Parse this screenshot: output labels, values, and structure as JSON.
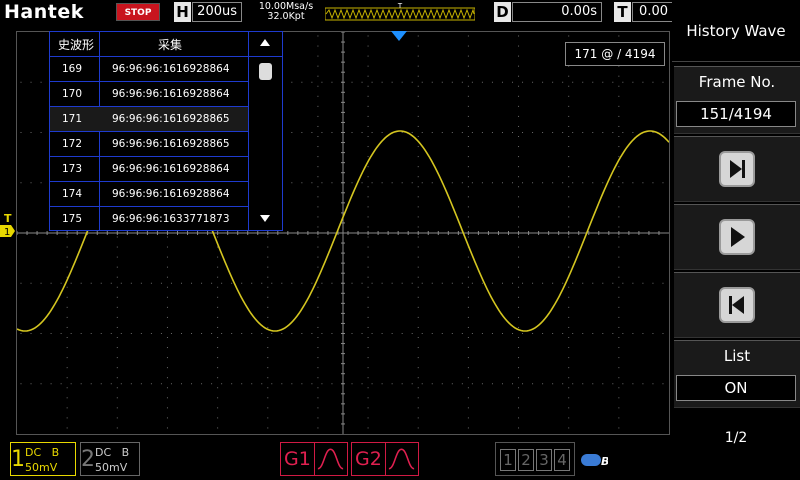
{
  "header": {
    "brand": "Hantek",
    "run_state": "STOP",
    "horizontal": {
      "letter": "H",
      "value": "200us"
    },
    "sample_rate": "10.00Msa/s",
    "memory_depth": "32.0Kpt",
    "trigger_marker": "T",
    "delay": {
      "letter": "D",
      "value": "0.00s"
    },
    "trigger_time": {
      "letter": "T",
      "value": "0.00"
    }
  },
  "screen": {
    "trigger_level_label": "T",
    "channel_marker": "1",
    "frame_readout": "171 @ / 4194"
  },
  "history_table": {
    "col1_header": "史波形",
    "col2_header": "采集",
    "rows": [
      {
        "index": "169",
        "timestamp": "96:96:96:1616928864"
      },
      {
        "index": "170",
        "timestamp": "96:96:96:1616928864"
      },
      {
        "index": "171",
        "timestamp": "96:96:96:1616928865"
      },
      {
        "index": "172",
        "timestamp": "96:96:96:1616928865"
      },
      {
        "index": "173",
        "timestamp": "96:96:96:1616928864"
      },
      {
        "index": "174",
        "timestamp": "96:96:96:1616928864"
      },
      {
        "index": "175",
        "timestamp": "96:96:96:1633771873"
      }
    ],
    "selected_index": "171"
  },
  "bottom": {
    "ch1": {
      "num": "1",
      "coupling": "DC",
      "bw": "B",
      "scale": "50mV"
    },
    "ch2": {
      "num": "2",
      "coupling": "DC",
      "bw": "B",
      "scale": "50mV"
    },
    "g1": "G1",
    "g2": "G2",
    "channel_selectors": [
      "1",
      "2",
      "3",
      "4"
    ],
    "bus_icon": "B"
  },
  "right_panel": {
    "title": "History Wave",
    "frame_label": "Frame No.",
    "frame_value": "151/4194",
    "buttons": [
      "next-frame-icon",
      "play-icon",
      "previous-frame-icon"
    ],
    "list_label": "List",
    "list_value": "ON",
    "page": "1/2"
  },
  "colors": {
    "trace": "#d4c520",
    "ch1": "#e8d800",
    "accent_red": "#c8141e",
    "grid": "#6a6a6a",
    "table_border": "#1e3bcf",
    "marker_blue": "#1e90ff"
  }
}
